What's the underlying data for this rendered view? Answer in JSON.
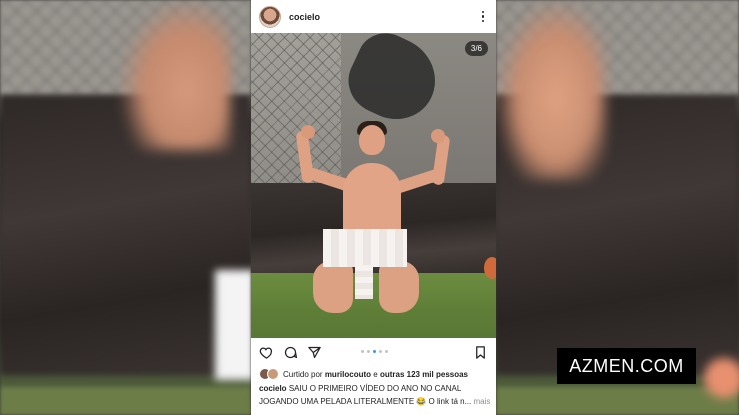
{
  "post": {
    "username": "cocielo",
    "image_counter": "3/6",
    "carousel": {
      "total_dots": 5,
      "active_index": 2
    },
    "liked_by": {
      "prefix": "Curtido por",
      "user": "murilocouto",
      "connector": "e",
      "others": "outras 123 mil pessoas"
    },
    "caption": {
      "user": "cocielo",
      "text": "SAIU O PRIMEIRO VÍDEO DO ANO NO CANAL JOGANDO UMA PELADA LITERALMENTE 😂 O link tá n...",
      "more": "mais"
    },
    "icons": [
      "heart-icon",
      "comment-icon",
      "share-icon",
      "bookmark-icon",
      "more-options-icon"
    ]
  },
  "watermark": "AZMEN.COM"
}
